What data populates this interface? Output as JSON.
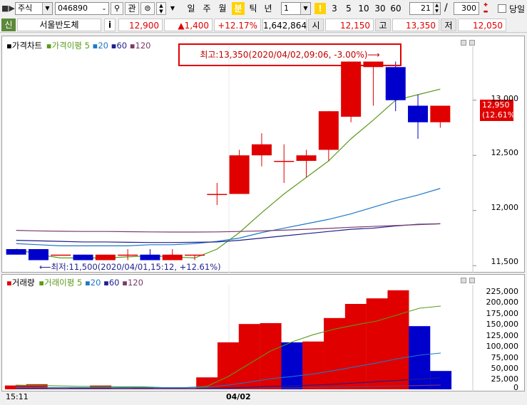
{
  "toolbar": {
    "market": "주식",
    "code": "046890",
    "kwan_label": "관",
    "periods": [
      "일",
      "주",
      "월",
      "분",
      "틱",
      "년"
    ],
    "active_period": "분",
    "interval_value": "1",
    "interval_presets": [
      "3",
      "5",
      "10",
      "30",
      "60"
    ],
    "count_value": "21",
    "slash": "/",
    "total_value": "300",
    "sameday_label": "당일"
  },
  "quote": {
    "credit_label": "신",
    "name": "서울반도체",
    "info_label": "i",
    "price": "12,900",
    "change": "▲1,400",
    "change_pct": "+12.17%",
    "volume": "1,642,864",
    "open_label": "시",
    "open": "12,150",
    "high_label": "고",
    "high": "13,350",
    "low_label": "저",
    "low": "12,050"
  },
  "price_panel": {
    "legend": {
      "title": "가격차트",
      "ma_title": "가격이평",
      "p5": "5",
      "p20": "20",
      "p60": "60",
      "p120": "120"
    },
    "high_annotation": "최고:13,350(2020/04/02,09:06, -3.00%)⟶",
    "low_annotation": "⟵최저:11,500(2020/04/01,15:12, +12.61%)",
    "current_price": "12,950",
    "current_pct": "(12.61%)",
    "y_ticks": [
      "13,000",
      "12,500",
      "12,000",
      "11,500"
    ]
  },
  "volume_panel": {
    "legend": {
      "title": "거래량",
      "ma_title": "거래이평",
      "p5": "5",
      "p20": "20",
      "p60": "60",
      "p120": "120"
    },
    "y_ticks": [
      "225,000",
      "200,000",
      "175,000",
      "150,000",
      "125,000",
      "100,000",
      "75,000",
      "50,000",
      "25,000",
      "0"
    ]
  },
  "x_axis": {
    "left_time": "15:11",
    "date_label": "04/02"
  },
  "colors": {
    "up": "#e00000",
    "down": "#0000cc",
    "ma5": "#5a9a1a",
    "ma20": "#1e78c8",
    "ma60": "#1e1e8c",
    "ma120": "#7a3a6a",
    "annotation_border": "#e00000",
    "active_tab": "#ffd200"
  },
  "chart_data": {
    "type": "candlestick",
    "candles": [
      {
        "open": 11650,
        "high": 11650,
        "low": 11600,
        "close": 11600
      },
      {
        "open": 11650,
        "high": 11650,
        "low": 11550,
        "close": 11550
      },
      {
        "open": 11600,
        "high": 11600,
        "low": 11600,
        "close": 11600
      },
      {
        "open": 11600,
        "high": 11600,
        "low": 11550,
        "close": 11550
      },
      {
        "open": 11550,
        "high": 11600,
        "low": 11550,
        "close": 11600
      },
      {
        "open": 11600,
        "high": 11650,
        "low": 11550,
        "close": 11600
      },
      {
        "open": 11600,
        "high": 11650,
        "low": 11550,
        "close": 11550
      },
      {
        "open": 11550,
        "high": 11650,
        "low": 11550,
        "close": 11600
      },
      {
        "open": 11600,
        "high": 11600,
        "low": 11550,
        "close": 11600
      },
      {
        "open": 12150,
        "high": 12250,
        "low": 12050,
        "close": 12150
      },
      {
        "open": 12150,
        "high": 12550,
        "low": 12150,
        "close": 12500
      },
      {
        "open": 12500,
        "high": 12700,
        "low": 12400,
        "close": 12600
      },
      {
        "open": 12450,
        "high": 12600,
        "low": 12250,
        "close": 12450
      },
      {
        "open": 12450,
        "high": 12550,
        "low": 12300,
        "close": 12500
      },
      {
        "open": 12550,
        "high": 12900,
        "low": 12450,
        "close": 12900
      },
      {
        "open": 12850,
        "high": 13350,
        "low": 12800,
        "close": 13350
      },
      {
        "open": 13300,
        "high": 13350,
        "low": 12950,
        "close": 13350
      },
      {
        "open": 13300,
        "high": 13350,
        "low": 12900,
        "close": 13000
      },
      {
        "open": 12950,
        "high": 13050,
        "low": 12650,
        "close": 12800
      },
      {
        "open": 12800,
        "high": 12950,
        "low": 12750,
        "close": 12950
      }
    ],
    "price_ma": {
      "ma5": [
        11650,
        11600,
        11570,
        11570,
        11570,
        11580,
        11590,
        11580,
        11570,
        11650,
        11800,
        11980,
        12150,
        12300,
        12450,
        12650,
        12820,
        13000,
        13050,
        13100
      ],
      "ma20": [
        11700,
        11690,
        11680,
        11680,
        11680,
        11680,
        11690,
        11690,
        11700,
        11720,
        11750,
        11800,
        11840,
        11880,
        11920,
        11970,
        12030,
        12090,
        12140,
        12200
      ],
      "ma60": [
        11730,
        11725,
        11720,
        11715,
        11715,
        11712,
        11710,
        11710,
        11712,
        11715,
        11730,
        11750,
        11770,
        11790,
        11810,
        11830,
        11840,
        11860,
        11875,
        11880
      ],
      "ma120": [
        11820,
        11815,
        11812,
        11810,
        11810,
        11808,
        11806,
        11805,
        11805,
        11806,
        11810,
        11815,
        11822,
        11830,
        11838,
        11848,
        11856,
        11864,
        11872,
        11880
      ]
    },
    "price_ylim": [
      11450,
      13450
    ],
    "volume": [
      9000,
      12000,
      2000,
      3000,
      9000,
      2000,
      3000,
      2000,
      2000,
      28000,
      110000,
      153000,
      155000,
      110000,
      112000,
      167000,
      200000,
      213000,
      232000,
      148000,
      43000
    ],
    "volume_up": [
      true,
      true,
      false,
      false,
      true,
      false,
      true,
      false,
      false,
      true,
      true,
      true,
      true,
      false,
      true,
      true,
      true,
      true,
      true,
      false,
      false
    ],
    "volume_ma": {
      "ma5": [
        10000,
        9000,
        8000,
        7000,
        7000,
        6000,
        6000,
        4000,
        4000,
        7000,
        30000,
        60000,
        90000,
        111000,
        128000,
        141000,
        151000,
        160000,
        175000,
        190000,
        195000
      ],
      "ma20": [
        4000,
        4000,
        4000,
        4000,
        4000,
        4000,
        4000,
        4000,
        4000,
        5000,
        10000,
        17000,
        25000,
        30000,
        36000,
        44000,
        53000,
        62000,
        72000,
        80000,
        85000
      ],
      "ma60": [
        2000,
        2000,
        2000,
        2000,
        2000,
        2000,
        2000,
        2000,
        2000,
        2000,
        3000,
        5000,
        7000,
        8000,
        10000,
        12000,
        15000,
        18000,
        21000,
        24000,
        27000
      ],
      "ma120": [
        1000,
        1000,
        1000,
        1000,
        1000,
        1000,
        1000,
        1000,
        1000,
        1000,
        1000,
        2000,
        3000,
        3000,
        4000,
        5000,
        6000,
        7000,
        8000,
        9000,
        10000
      ]
    },
    "volume_ylim": [
      0,
      245000
    ]
  }
}
